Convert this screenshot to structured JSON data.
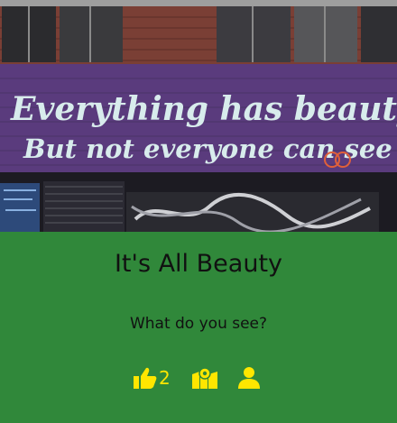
{
  "image": {
    "alt": "Graffiti mural on a brick wall",
    "mural_line1": "Everything has beauty",
    "mural_line2": "But not everyone can see it"
  },
  "card": {
    "title": "It's All Beauty",
    "subtitle": "What do you see?",
    "like_count": "2"
  },
  "icons": {
    "like": "thumbs-up-icon",
    "map": "map-marker-icon",
    "user": "user-icon"
  },
  "colors": {
    "caption_bg": "#30883a",
    "icon": "#ffe600",
    "text": "#111111"
  }
}
